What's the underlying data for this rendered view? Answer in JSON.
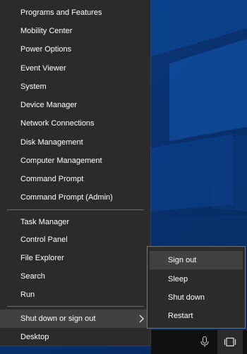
{
  "menu": {
    "items": [
      {
        "label": "Programs and Features"
      },
      {
        "label": "Mobility Center"
      },
      {
        "label": "Power Options"
      },
      {
        "label": "Event Viewer"
      },
      {
        "label": "System"
      },
      {
        "label": "Device Manager"
      },
      {
        "label": "Network Connections"
      },
      {
        "label": "Disk Management"
      },
      {
        "label": "Computer Management"
      },
      {
        "label": "Command Prompt"
      },
      {
        "label": "Command Prompt (Admin)"
      },
      {
        "label": "Task Manager"
      },
      {
        "label": "Control Panel"
      },
      {
        "label": "File Explorer"
      },
      {
        "label": "Search"
      },
      {
        "label": "Run"
      },
      {
        "label": "Shut down or sign out"
      },
      {
        "label": "Desktop"
      }
    ]
  },
  "submenu": {
    "items": [
      {
        "label": "Sign out"
      },
      {
        "label": "Sleep"
      },
      {
        "label": "Shut down"
      },
      {
        "label": "Restart"
      }
    ]
  },
  "taskbar": {
    "icons": [
      "microphone-icon",
      "task-view-icon"
    ]
  },
  "colors": {
    "menu_bg": "#2b2b2b",
    "hover_bg": "#414141",
    "desktop_blue": "#0b3d86"
  }
}
